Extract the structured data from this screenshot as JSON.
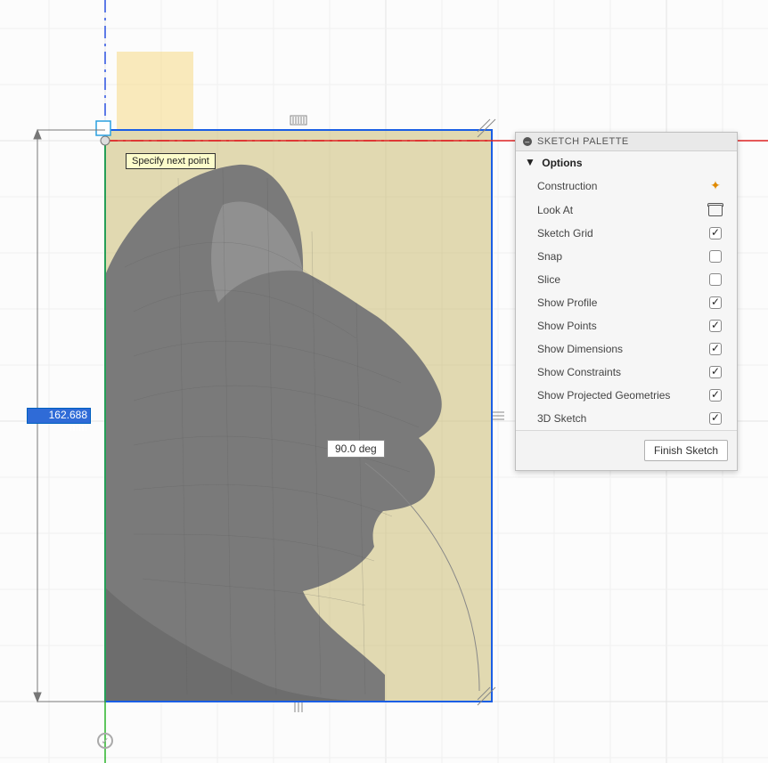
{
  "tooltip": {
    "next_point": "Specify next point"
  },
  "angle_label": "90.0 deg",
  "dimension_value": "162.688 mm",
  "palette": {
    "title": "SKETCH PALETTE",
    "section": "Options",
    "finish_label": "Finish Sketch",
    "options": {
      "construction": "Construction",
      "look_at": "Look At",
      "sketch_grid": "Sketch Grid",
      "snap": "Snap",
      "slice": "Slice",
      "show_profile": "Show Profile",
      "show_points": "Show Points",
      "show_dimensions": "Show Dimensions",
      "show_constraints": "Show Constraints",
      "show_projected": "Show Projected Geometries",
      "3d_sketch": "3D Sketch"
    }
  },
  "checkbox_states": {
    "sketch_grid": true,
    "snap": false,
    "slice": false,
    "show_profile": true,
    "show_points": true,
    "show_dimensions": true,
    "show_constraints": true,
    "show_projected": true,
    "3d_sketch": true
  }
}
